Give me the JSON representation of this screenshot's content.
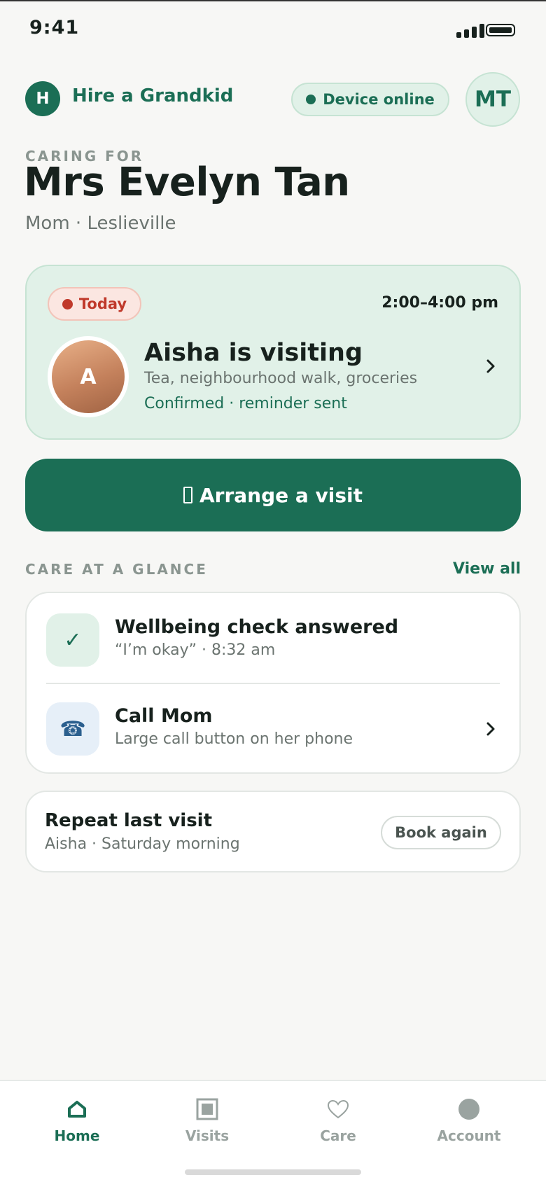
{
  "status_bar": {
    "time": "9:41"
  },
  "header": {
    "logo_letter": "H",
    "brand": "Hire a Grandkid",
    "device_status": "Device online",
    "user_initials": "MT"
  },
  "caring_for": {
    "label": "CARING FOR",
    "name": "Mrs Evelyn Tan",
    "subtitle": "Mom · Leslieville"
  },
  "visit_card": {
    "badge": "Today",
    "time": "2:00–4:00 pm",
    "visitor_initial": "A",
    "title": "Aisha is visiting",
    "description": "Tea, neighbourhood walk, groceries",
    "status": "Confirmed · reminder sent"
  },
  "arrange_button": {
    "label": "Arrange a visit"
  },
  "care_section": {
    "label": "CARE AT A GLANCE",
    "view_all": "View all",
    "items": [
      {
        "icon": "check-icon",
        "title": "Wellbeing check answered",
        "subtitle": "“I’m okay” · 8:32 am"
      },
      {
        "icon": "phone-icon",
        "title": "Call Mom",
        "subtitle": "Large call button on her phone"
      }
    ]
  },
  "repeat_card": {
    "title": "Repeat last visit",
    "subtitle": "Aisha · Saturday morning",
    "button": "Book again"
  },
  "tab_bar": {
    "active": "Home",
    "tabs": [
      {
        "label": "Home",
        "icon": "home-icon"
      },
      {
        "label": "Visits",
        "icon": "calendar-icon"
      },
      {
        "label": "Care",
        "icon": "heart-icon"
      },
      {
        "label": "Account",
        "icon": "account-icon"
      }
    ]
  },
  "colors": {
    "brand_green": "#1b6e55",
    "mint": "#e1f1e8",
    "alert_red": "#c0392b",
    "background": "#f7f7f5"
  }
}
